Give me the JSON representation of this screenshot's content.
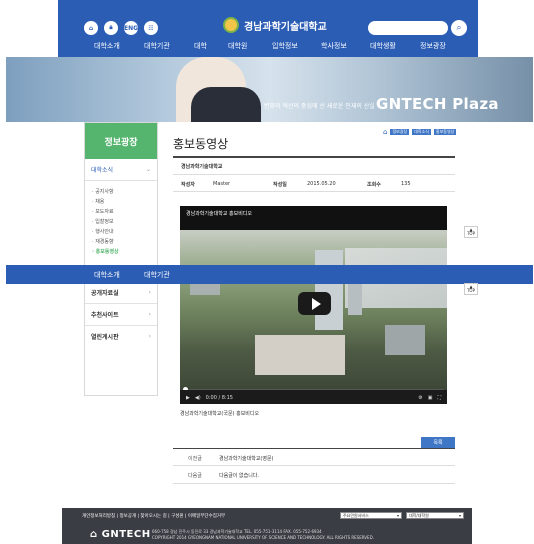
{
  "header": {
    "icons": [
      "home-icon",
      "lock-icon",
      "eng-label",
      "sitemap-icon"
    ],
    "eng_label": "ENG",
    "logo_text": "경남과학기술대학교",
    "search_placeholder": "",
    "nav": [
      "대학소개",
      "대학기관",
      "대학",
      "대학원",
      "입학정보",
      "학사정보",
      "대학생활",
      "정보광장"
    ]
  },
  "banner": {
    "subtitle": "변화와 혁신의 중심에 선 새로운 인재의 산실",
    "title": "GNTECH Plaza"
  },
  "sidebar": {
    "title": "정보광장",
    "section": "대학소식",
    "sub_items": [
      "공지사항",
      "채용",
      "보도자료",
      "입찰정보",
      "행사안내",
      "재경동향",
      "홍보동영상"
    ],
    "active_index": 6,
    "items": [
      "공개자료실",
      "추천사이트",
      "열린게시판"
    ]
  },
  "sticky_nav": [
    "대학소개",
    "대학기관"
  ],
  "content": {
    "page_title": "홍보동영상",
    "breadcrumb": [
      "정보광장",
      "대학소식",
      "홍보동영상"
    ],
    "post_name": "경남과학기술대학교",
    "meta": {
      "author_label": "작성자",
      "author": "Master",
      "date_label": "작성일",
      "date": "2015.05.20",
      "views_label": "조회수",
      "views": "135"
    },
    "video": {
      "title": "경남과학기술대학교 홍보비디오",
      "time": "0:00 / 8:15"
    },
    "caption": "경남과학기술대학교(국문) 홍보비디오",
    "list_button": "목록",
    "prev_label": "이전글",
    "prev_title": "경남과학기술대학교(영문)",
    "next_label": "다음글",
    "next_title": "다음글이 없습니다."
  },
  "top_button": "TOP",
  "footer": {
    "links": "개인정보처리방침 | 정보공개 | 찾아오시는 길 | 구성원 | 이메일무단수집거부",
    "select1": "주요민원서비스",
    "select2": "대학/대학원",
    "logo": "GNTECH",
    "address": "660-758 경남 진주시 동진로 33 경남과학기술대학교 TEL. 055-751-3114  FAX. 055-752-6934",
    "copyright": "COPYRIGHT 2014 GYEONGNAM NATIONAL UNIVERSITY OF SCIENCE AND TECHNOLOGY. ALL RIGHTS RESERVED."
  },
  "colors": {
    "primary": "#2b5db5",
    "accent_green": "#55b56f",
    "footer": "#3b3d44"
  }
}
